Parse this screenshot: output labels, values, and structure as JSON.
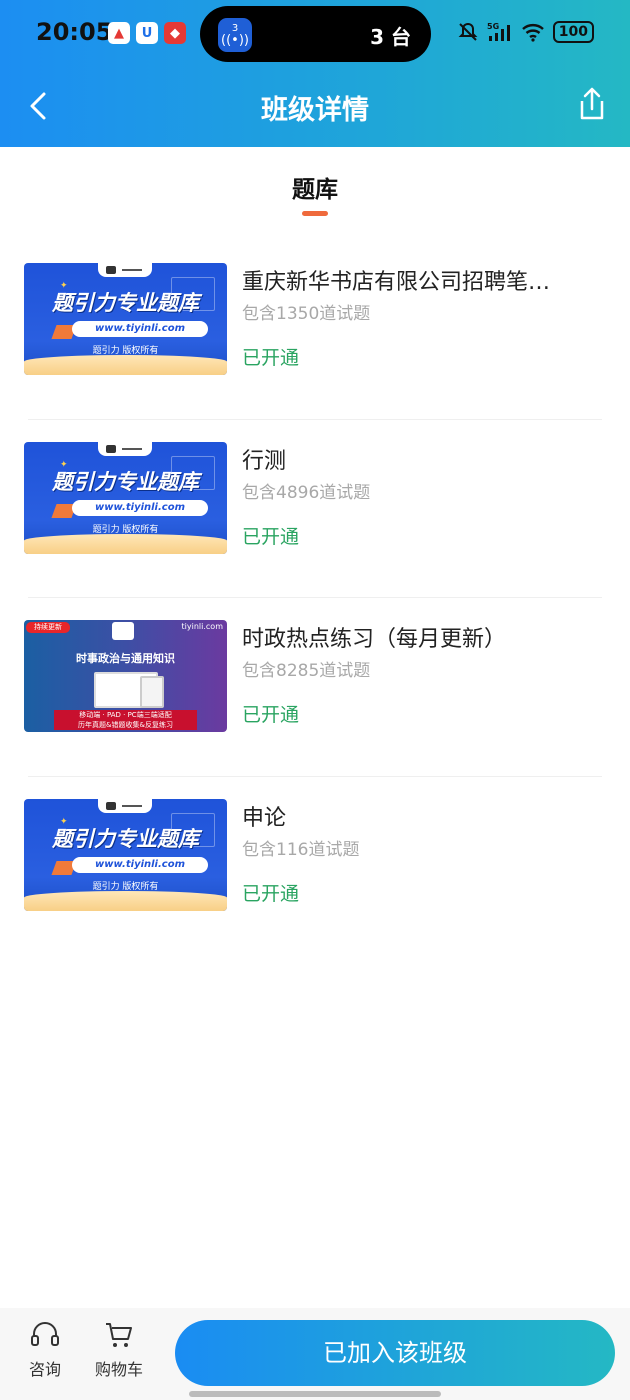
{
  "status_bar": {
    "time": "20:05",
    "island_badge": "3",
    "island_text": "3 台",
    "battery": "100",
    "signal": "5G"
  },
  "nav": {
    "title": "班级详情"
  },
  "tab": {
    "title": "题库"
  },
  "thumbnail": {
    "brand": "题引力专业题库",
    "url": "www.tiyinli.com",
    "copyright": "题引力 版权所有",
    "logo_text": "题引力"
  },
  "thumbnail_news": {
    "badge": "持续更新",
    "site": "tiyinli.com",
    "headline": "时事政治与通用知识",
    "footer_line1": "移动端 · PAD · PC端三端适配",
    "footer_line2": "历年真题&错题收集&反复练习"
  },
  "items": [
    {
      "title": "重庆新华书店有限公司招聘笔…",
      "count": "包含1350道试题",
      "status": "已开通",
      "thumb": "blue"
    },
    {
      "title": "行测",
      "count": "包含4896道试题",
      "status": "已开通",
      "thumb": "blue"
    },
    {
      "title": "时政热点练习（每月更新）",
      "count": "包含8285道试题",
      "status": "已开通",
      "thumb": "news"
    },
    {
      "title": "申论",
      "count": "包含116道试题",
      "status": "已开通",
      "thumb": "blue"
    }
  ],
  "bottom": {
    "consult": "咨询",
    "cart": "购物车",
    "joined_button": "已加入该班级"
  },
  "colors": {
    "accent_gradient_start": "#1c8ef2",
    "accent_gradient_end": "#24b8c4",
    "status_green": "#2aa461",
    "tab_underline": "#ef6a3c"
  }
}
